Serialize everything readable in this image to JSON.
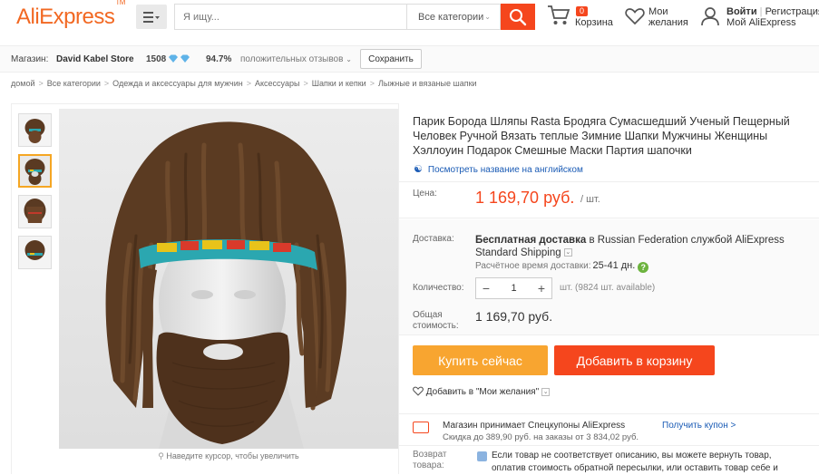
{
  "header": {
    "logo": "AliExpress",
    "logo_tm": "TM",
    "search_placeholder": "Я ищу...",
    "search_category": "Все категории",
    "cart_count": "0",
    "cart_label": "Корзина",
    "wishlist_label_line1": "Мои",
    "wishlist_label_line2": "желания",
    "login": "Войти",
    "divider": "|",
    "register": "Регистрация",
    "my_aliexpress": "Мой AliExpress"
  },
  "store": {
    "label": "Магазин:",
    "name": "David Kabel Store",
    "score": "1508",
    "positive_pct": "94.7%",
    "positive_label": "положительных отзывов",
    "save_label": "Сохранить"
  },
  "breadcrumb": [
    "домой",
    "Все категории",
    "Одежда и аксессуары для мужчин",
    "Аксессуары",
    "Шапки и кепки",
    "Лыжные и вязаные шапки"
  ],
  "gallery": {
    "zoom_hint": "Наведите курсор, чтобы увеличить",
    "thumb_count": 4,
    "active_thumb": 2
  },
  "product": {
    "title": "Парик Борода Шляпы Rasta Бродяга Сумасшедший Ученый Пещерный Человек Ручной Вязать теплые Зимние Шапки Мужчины Женщины Хэллоуин Подарок Смешные Маски Партия шапочки",
    "translate_link": "Посмотреть название на английском",
    "price_label": "Цена:",
    "price": "1 169,70 руб.",
    "price_unit": "/ шт.",
    "delivery_label": "Доставка:",
    "delivery_free": "Бесплатная доставка",
    "delivery_in": "в",
    "delivery_rest": "Russian Federation службой AliExpress Standard Shipping",
    "eta_label": "Расчётное время доставки:",
    "eta_days": "25-41 дн.",
    "qty_label": "Количество:",
    "qty_value": "1",
    "qty_available": "шт. (9824 шт. available)",
    "total_label_1": "Общая",
    "total_label_2": "стоимость:",
    "total": "1 169,70 руб.",
    "buy_now": "Купить сейчас",
    "add_to_cart": "Добавить в корзину",
    "add_wishlist": "Добавить в \"Мои желания\"",
    "coupon_title": "Магазин принимает Спецкупоны AliExpress",
    "coupon_detail": "Скидка до 389,90 руб. на заказы от 3 834,02 руб.",
    "coupon_link": "Получить купон >",
    "return_label_1": "Возврат",
    "return_label_2": "товара:",
    "return_text": "Если товар не соответствует описанию, вы можете вернуть товар, оплатив стоимость обратной пересылки, или оставить товар себе и"
  },
  "colors": {
    "brand": "#f26822",
    "price": "#f5461d",
    "buy": "#f8a530",
    "cart": "#f5461d",
    "link": "#1a5bb5"
  }
}
